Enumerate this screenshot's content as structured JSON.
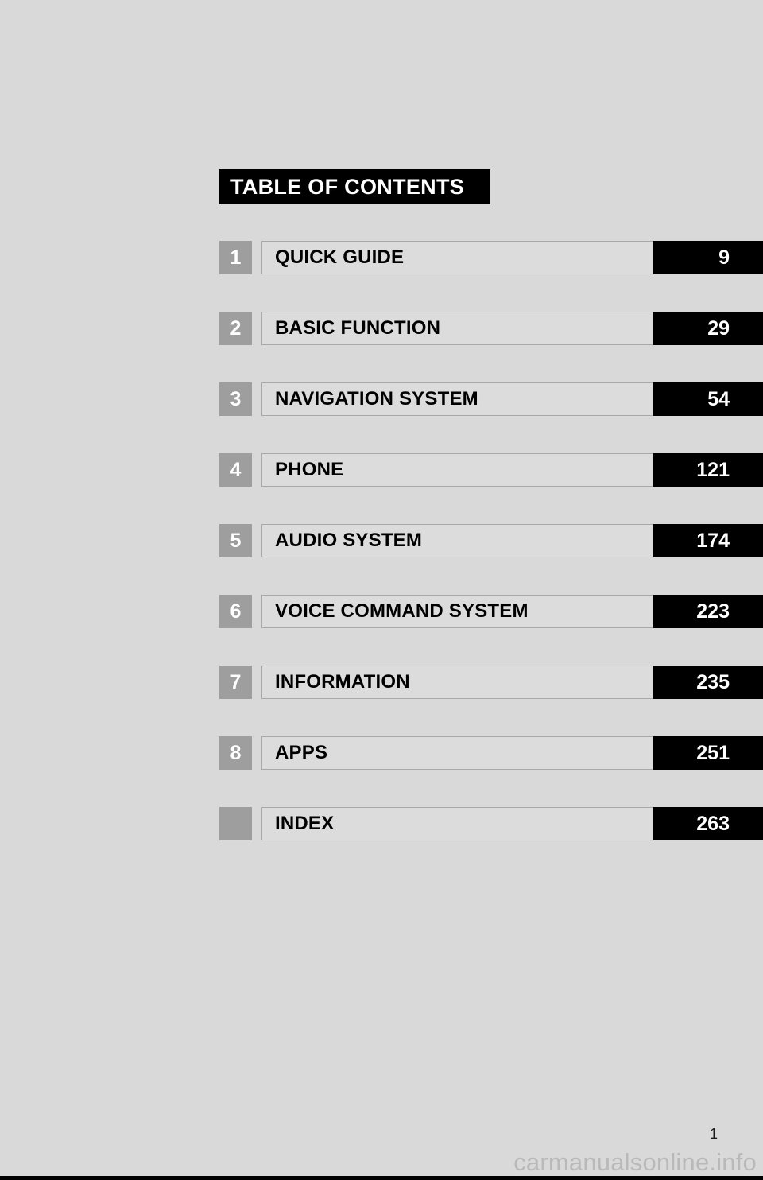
{
  "document": {
    "title": "TABLE OF CONTENTS",
    "folio": "1",
    "watermark": "carmanualsonline.info"
  },
  "colors": {
    "page_background": "#d9d9d9",
    "banner_background": "#000000",
    "banner_text": "#ffffff",
    "number_box": "#9e9e9e",
    "label_background": "#dcdcdc",
    "label_border": "#a8a8a8",
    "page_block": "#000000",
    "watermark_text": "#b9b9b9"
  },
  "entries": [
    {
      "number": "1",
      "label": "QUICK GUIDE",
      "page": "9"
    },
    {
      "number": "2",
      "label": "BASIC FUNCTION",
      "page": "29"
    },
    {
      "number": "3",
      "label": "NAVIGATION SYSTEM",
      "page": "54"
    },
    {
      "number": "4",
      "label": "PHONE",
      "page": "121"
    },
    {
      "number": "5",
      "label": "AUDIO SYSTEM",
      "page": "174"
    },
    {
      "number": "6",
      "label": "VOICE COMMAND SYSTEM",
      "page": "223"
    },
    {
      "number": "7",
      "label": "INFORMATION",
      "page": "235"
    },
    {
      "number": "8",
      "label": "APPS",
      "page": "251"
    },
    {
      "number": "",
      "label": "INDEX",
      "page": "263"
    }
  ]
}
